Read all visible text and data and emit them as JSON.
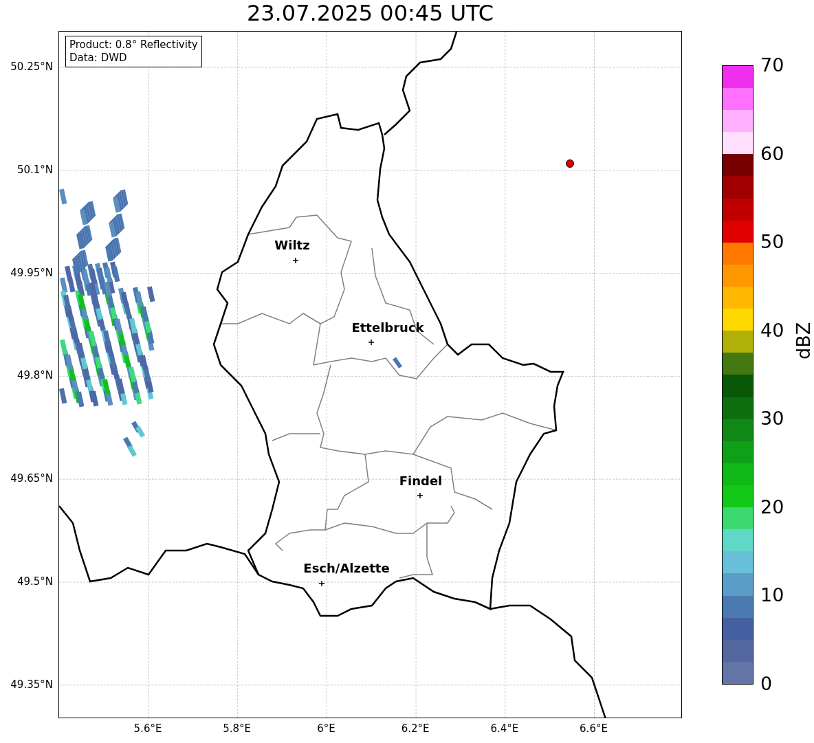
{
  "title": "23.07.2025 00:45 UTC",
  "info_box": {
    "lines": [
      "Product: 0.8° Reflectivity",
      "Data: DWD"
    ]
  },
  "lat_ticks": [
    "50.25°N",
    "50.1°N",
    "49.95°N",
    "49.8°N",
    "49.65°N",
    "49.5°N",
    "49.35°N"
  ],
  "lon_ticks": [
    "5.6°E",
    "5.8°E",
    "6°E",
    "6.2°E",
    "6.4°E",
    "6.6°E"
  ],
  "cities": [
    {
      "name": "Wiltz"
    },
    {
      "name": "Ettelbruck"
    },
    {
      "name": "Findel"
    },
    {
      "name": "Esch/Alzette"
    }
  ],
  "colorbar": {
    "label": "dBZ",
    "ticks": [
      "70",
      "60",
      "50",
      "40",
      "30",
      "20",
      "10",
      "0"
    ],
    "bins": [
      {
        "color": "#6476a8"
      },
      {
        "color": "#5468a0"
      },
      {
        "color": "#4560a0"
      },
      {
        "color": "#4a7ab0"
      },
      {
        "color": "#5a9ec8"
      },
      {
        "color": "#68c0d8"
      },
      {
        "color": "#60d8c8"
      },
      {
        "color": "#3cd870"
      },
      {
        "color": "#14c818"
      },
      {
        "color": "#10b818"
      },
      {
        "color": "#10a018"
      },
      {
        "color": "#108818"
      },
      {
        "color": "#0c7010"
      },
      {
        "color": "#085808"
      },
      {
        "color": "#447810"
      },
      {
        "color": "#b0b008"
      },
      {
        "color": "#ffd800"
      },
      {
        "color": "#ffb800"
      },
      {
        "color": "#ff9800"
      },
      {
        "color": "#ff7800"
      },
      {
        "color": "#e00000"
      },
      {
        "color": "#c00000"
      },
      {
        "color": "#a00000"
      },
      {
        "color": "#780000"
      },
      {
        "color": "#ffe0ff"
      },
      {
        "color": "#ffb0ff"
      },
      {
        "color": "#ff70ff"
      },
      {
        "color": "#ee30ee"
      }
    ]
  }
}
